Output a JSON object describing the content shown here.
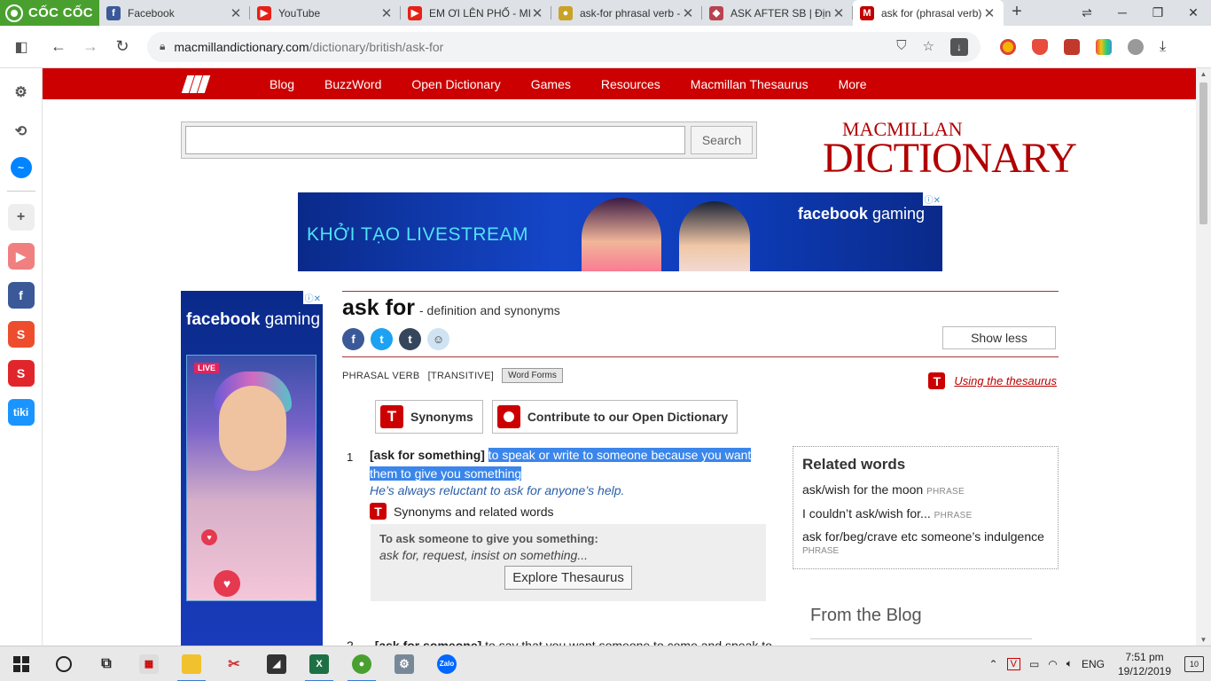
{
  "browser": {
    "brand": "CỐC CỐC",
    "tabs": [
      {
        "title": "Facebook",
        "icon": "facebook-icon",
        "color": "#3b5998",
        "active": false
      },
      {
        "title": "YouTube",
        "icon": "youtube-icon",
        "color": "#e62117",
        "active": false
      },
      {
        "title": "EM ƠI LÊN PHỐ - MIN",
        "icon": "youtube-icon",
        "color": "#e62117",
        "active": false
      },
      {
        "title": "ask-for phrasal verb -",
        "icon": "page-icon",
        "color": "#c9a227",
        "active": false
      },
      {
        "title": "ASK AFTER SB | Định n",
        "icon": "cambridge-icon",
        "color": "#b8434f",
        "active": false
      },
      {
        "title": "ask for (phrasal verb)",
        "icon": "macmillan-icon",
        "color": "#c00000",
        "active": true
      }
    ],
    "url_host": "macmillandictionary.com",
    "url_path": "/dictionary/british/ask-for"
  },
  "site": {
    "nav": [
      "Blog",
      "BuzzWord",
      "Open Dictionary",
      "Games",
      "Resources",
      "Macmillan Thesaurus",
      "More"
    ],
    "search_placeholder": "",
    "search_button": "Search",
    "logo_line1": "MACMILLAN",
    "logo_line2": "DICTIONARY"
  },
  "ads": {
    "banner_text": "KHỞI TẠO LIVESTREAM",
    "banner_brand_bold": "facebook",
    "banner_brand_light": "gaming",
    "side_brand_bold": "facebook",
    "side_brand_light": "gaming",
    "live_label": "LIVE",
    "adinfo": "ⓘ✕"
  },
  "entry": {
    "headword": "ask for",
    "subtitle": "- definition and synonyms",
    "show_less": "Show less",
    "pos": "PHRASAL VERB",
    "grammar": "[TRANSITIVE]",
    "word_forms": "Word Forms",
    "using_thesaurus": "Using the thesaurus",
    "synonyms_btn": "Synonyms",
    "contribute_btn": "Contribute to our Open Dictionary",
    "sense1": {
      "num": "1",
      "pattern": "[ask for something]",
      "definition": "to speak or write to someone because you want them to give you something",
      "example": "He’s always reluctant to ask for anyone’s help.",
      "syn_label": "Synonyms and related words",
      "thes_heading": "To ask someone to give you something:",
      "thes_words": "ask for, request, insist on something...",
      "explore_btn": "Explore Thesaurus"
    },
    "sense2": {
      "num": "2",
      "pattern": "[ask for someone]",
      "definition": "to say that you want someone to come and speak to"
    }
  },
  "related": {
    "title": "Related words",
    "items": [
      {
        "phrase": "ask/wish for the moon",
        "tag": "PHRASE"
      },
      {
        "phrase": "I couldn’t ask/wish for...",
        "tag": "PHRASE"
      },
      {
        "phrase": "ask for/beg/crave etc someone’s indulgence",
        "tag": "PHRASE"
      }
    ]
  },
  "blog_title": "From the Blog",
  "taskbar": {
    "lang": "ENG",
    "time": "7:51 pm",
    "date": "19/12/2019",
    "notifications": "10"
  }
}
